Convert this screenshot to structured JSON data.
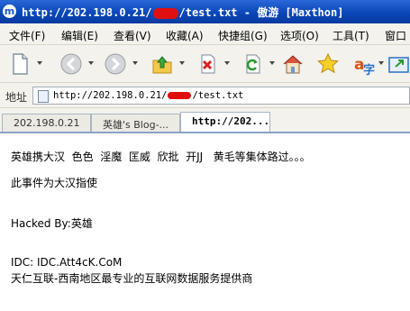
{
  "window": {
    "title_prefix": "http://202.198.0.21/",
    "title_suffix": "/test.txt - 傲游 [Maxthon]"
  },
  "menu": {
    "items": [
      "文件(F)",
      "编辑(E)",
      "查看(V)",
      "收藏(A)",
      "快捷组(G)",
      "选项(O)",
      "工具(T)",
      "窗口"
    ]
  },
  "address": {
    "label": "地址",
    "url_prefix": "http://202.198.0.21/",
    "url_suffix": "/test.txt"
  },
  "tabs": [
    {
      "label": "202.198.0.21"
    },
    {
      "label": "英雄's Blog-..."
    },
    {
      "label": "http://202..."
    }
  ],
  "content": {
    "lines": [
      "英雄携大汉  色色  淫魔  匡威  欣批  开JJ   黄毛等集体路过。。。",
      "此事件为大汉指使",
      "Hacked By:英雄",
      "IDC: IDC.Att4cK.CoM",
      "天仁互联-西南地区最专业的互联网数据服务提供商"
    ]
  },
  "colors": {
    "titlebar": "#0a47b8",
    "redaction": "#e01010"
  }
}
